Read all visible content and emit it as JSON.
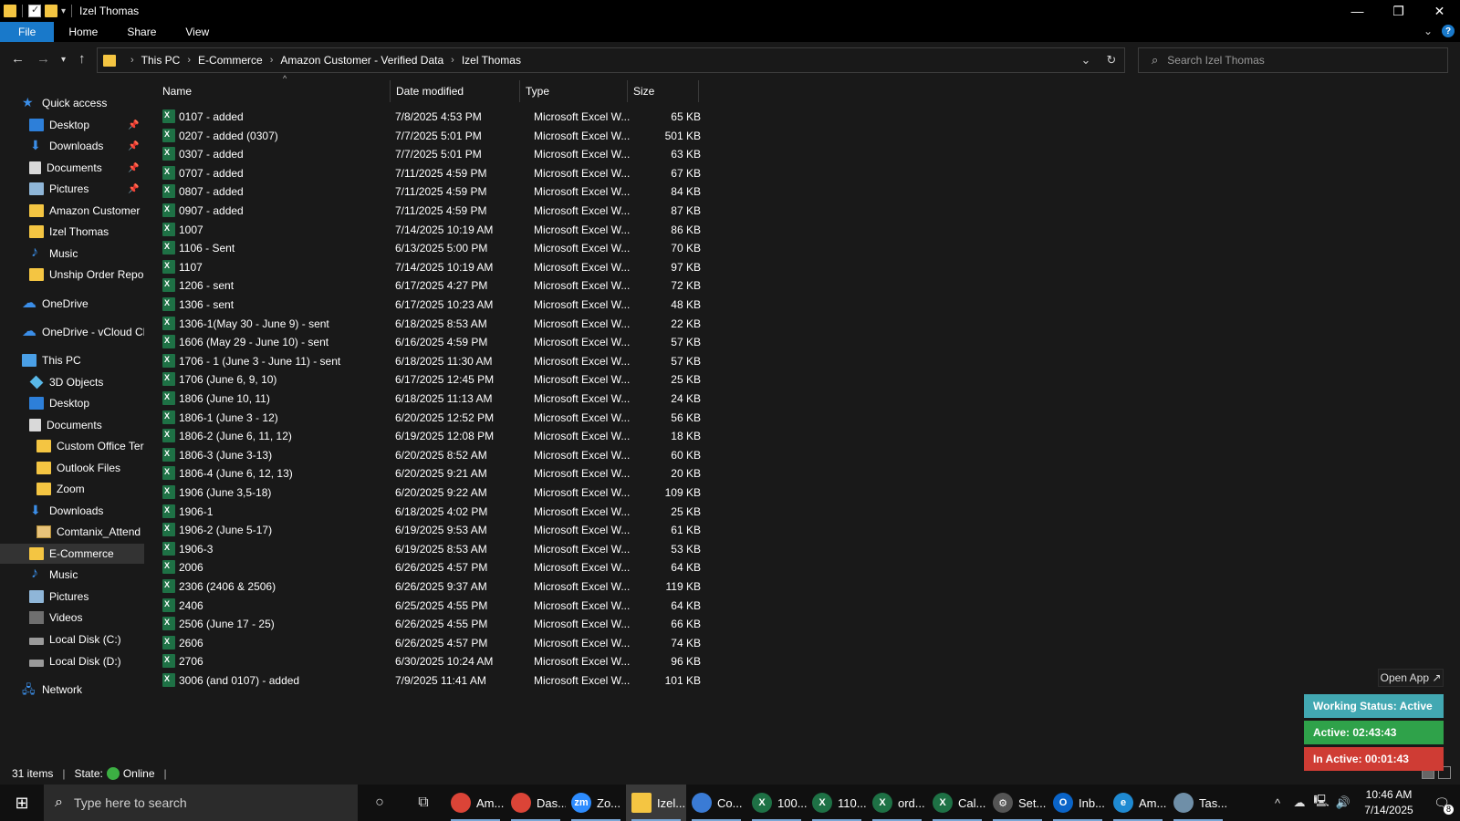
{
  "window": {
    "title": "Izel Thomas",
    "controls": {
      "minimize": "—",
      "maximize": "❐",
      "close": "✕"
    }
  },
  "ribbon": {
    "tabs": [
      "File",
      "Home",
      "Share",
      "View"
    ],
    "help": "?"
  },
  "address": {
    "crumbs": [
      "This PC",
      "E-Commerce",
      "Amazon Customer - Verified Data",
      "Izel Thomas"
    ]
  },
  "search": {
    "placeholder": "Search Izel Thomas"
  },
  "nav": [
    {
      "label": "Quick access",
      "icon": "star-icon",
      "indent": 0
    },
    {
      "label": "Desktop",
      "icon": "desktop-icon",
      "indent": 1,
      "pinned": true
    },
    {
      "label": "Downloads",
      "icon": "download-icon",
      "indent": 1,
      "pinned": true
    },
    {
      "label": "Documents",
      "icon": "documents-icon",
      "indent": 1,
      "pinned": true
    },
    {
      "label": "Pictures",
      "icon": "pictures-icon",
      "indent": 1,
      "pinned": true
    },
    {
      "label": "Amazon Customer",
      "icon": "folder-icon",
      "indent": 1
    },
    {
      "label": "Izel Thomas",
      "icon": "folder-icon",
      "indent": 1
    },
    {
      "label": "Music",
      "icon": "music-icon",
      "indent": 1
    },
    {
      "label": "Unship Order Repor",
      "icon": "folder-icon",
      "indent": 1
    },
    {
      "label": "OneDrive",
      "icon": "cloud-icon",
      "indent": 0
    },
    {
      "label": "OneDrive - vCloud Cl",
      "icon": "cloud-icon",
      "indent": 0
    },
    {
      "label": "This PC",
      "icon": "pc-icon",
      "indent": 0
    },
    {
      "label": "3D Objects",
      "icon": "3d-objects-icon",
      "indent": 1
    },
    {
      "label": "Desktop",
      "icon": "desktop-icon",
      "indent": 1
    },
    {
      "label": "Documents",
      "icon": "documents-icon",
      "indent": 1
    },
    {
      "label": "Custom Office Ter",
      "icon": "folder-icon",
      "indent": 2
    },
    {
      "label": "Outlook Files",
      "icon": "folder-icon",
      "indent": 2
    },
    {
      "label": "Zoom",
      "icon": "folder-icon",
      "indent": 2
    },
    {
      "label": "Downloads",
      "icon": "download-icon",
      "indent": 1
    },
    {
      "label": "Comtanix_Attend",
      "icon": "zip-folder-icon",
      "indent": 2
    },
    {
      "label": "E-Commerce",
      "icon": "folder-icon",
      "indent": 1,
      "selected": true
    },
    {
      "label": "Music",
      "icon": "music-icon",
      "indent": 1
    },
    {
      "label": "Pictures",
      "icon": "pictures-icon",
      "indent": 1
    },
    {
      "label": "Videos",
      "icon": "videos-icon",
      "indent": 1
    },
    {
      "label": "Local Disk (C:)",
      "icon": "disk-icon",
      "indent": 1
    },
    {
      "label": "Local Disk (D:)",
      "icon": "disk-icon",
      "indent": 1
    },
    {
      "label": "Network",
      "icon": "network-icon",
      "indent": 0
    }
  ],
  "columns": {
    "name": "Name",
    "date": "Date modified",
    "type": "Type",
    "size": "Size"
  },
  "files": [
    {
      "name": "0107 - added",
      "date": "7/8/2025 4:53 PM",
      "type": "Microsoft Excel W...",
      "size": "65 KB"
    },
    {
      "name": "0207 - added (0307)",
      "date": "7/7/2025 5:01 PM",
      "type": "Microsoft Excel W...",
      "size": "501 KB"
    },
    {
      "name": "0307 - added",
      "date": "7/7/2025 5:01 PM",
      "type": "Microsoft Excel W...",
      "size": "63 KB"
    },
    {
      "name": "0707 - added",
      "date": "7/11/2025 4:59 PM",
      "type": "Microsoft Excel W...",
      "size": "67 KB"
    },
    {
      "name": "0807 - added",
      "date": "7/11/2025 4:59 PM",
      "type": "Microsoft Excel W...",
      "size": "84 KB"
    },
    {
      "name": "0907 - added",
      "date": "7/11/2025 4:59 PM",
      "type": "Microsoft Excel W...",
      "size": "87 KB"
    },
    {
      "name": "1007",
      "date": "7/14/2025 10:19 AM",
      "type": "Microsoft Excel W...",
      "size": "86 KB"
    },
    {
      "name": "1106 - Sent",
      "date": "6/13/2025 5:00 PM",
      "type": "Microsoft Excel W...",
      "size": "70 KB"
    },
    {
      "name": "1107",
      "date": "7/14/2025 10:19 AM",
      "type": "Microsoft Excel W...",
      "size": "97 KB"
    },
    {
      "name": "1206 - sent",
      "date": "6/17/2025 4:27 PM",
      "type": "Microsoft Excel W...",
      "size": "72 KB"
    },
    {
      "name": "1306 - sent",
      "date": "6/17/2025 10:23 AM",
      "type": "Microsoft Excel W...",
      "size": "48 KB"
    },
    {
      "name": "1306-1(May 30 - June 9) - sent",
      "date": "6/18/2025 8:53 AM",
      "type": "Microsoft Excel W...",
      "size": "22 KB"
    },
    {
      "name": "1606 (May 29 - June 10) - sent",
      "date": "6/16/2025 4:59 PM",
      "type": "Microsoft Excel W...",
      "size": "57 KB"
    },
    {
      "name": "1706 - 1 (June 3 - June 11) - sent",
      "date": "6/18/2025 11:30 AM",
      "type": "Microsoft Excel W...",
      "size": "57 KB"
    },
    {
      "name": "1706 (June 6, 9, 10)",
      "date": "6/17/2025 12:45 PM",
      "type": "Microsoft Excel W...",
      "size": "25 KB"
    },
    {
      "name": "1806 (June 10, 11)",
      "date": "6/18/2025 11:13 AM",
      "type": "Microsoft Excel W...",
      "size": "24 KB"
    },
    {
      "name": "1806-1 (June 3 - 12)",
      "date": "6/20/2025 12:52 PM",
      "type": "Microsoft Excel W...",
      "size": "56 KB"
    },
    {
      "name": "1806-2 (June 6, 11, 12)",
      "date": "6/19/2025 12:08 PM",
      "type": "Microsoft Excel W...",
      "size": "18 KB"
    },
    {
      "name": "1806-3 (June 3-13)",
      "date": "6/20/2025 8:52 AM",
      "type": "Microsoft Excel W...",
      "size": "60 KB"
    },
    {
      "name": "1806-4 (June 6, 12, 13)",
      "date": "6/20/2025 9:21 AM",
      "type": "Microsoft Excel W...",
      "size": "20 KB"
    },
    {
      "name": "1906 (June 3,5-18)",
      "date": "6/20/2025 9:22 AM",
      "type": "Microsoft Excel W...",
      "size": "109 KB"
    },
    {
      "name": "1906-1",
      "date": "6/18/2025 4:02 PM",
      "type": "Microsoft Excel W...",
      "size": "25 KB"
    },
    {
      "name": "1906-2 (June 5-17)",
      "date": "6/19/2025 9:53 AM",
      "type": "Microsoft Excel W...",
      "size": "61 KB"
    },
    {
      "name": "1906-3",
      "date": "6/19/2025 8:53 AM",
      "type": "Microsoft Excel W...",
      "size": "53 KB"
    },
    {
      "name": "2006",
      "date": "6/26/2025 4:57 PM",
      "type": "Microsoft Excel W...",
      "size": "64 KB"
    },
    {
      "name": "2306 (2406 & 2506)",
      "date": "6/26/2025 9:37 AM",
      "type": "Microsoft Excel W...",
      "size": "119 KB"
    },
    {
      "name": "2406",
      "date": "6/25/2025 4:55 PM",
      "type": "Microsoft Excel W...",
      "size": "64 KB"
    },
    {
      "name": "2506 (June 17 - 25)",
      "date": "6/26/2025 4:55 PM",
      "type": "Microsoft Excel W...",
      "size": "66 KB"
    },
    {
      "name": "2606",
      "date": "6/26/2025 4:57 PM",
      "type": "Microsoft Excel W...",
      "size": "74 KB"
    },
    {
      "name": "2706",
      "date": "6/30/2025 10:24 AM",
      "type": "Microsoft Excel W...",
      "size": "96 KB"
    },
    {
      "name": "3006 (and 0107) - added",
      "date": "7/9/2025 11:41 AM",
      "type": "Microsoft Excel W...",
      "size": "101 KB"
    }
  ],
  "status": {
    "items": "31 items",
    "state_label": "State:",
    "state_value": "Online"
  },
  "widget": {
    "open_app": "Open App ↗",
    "working_status": "Working Status: Active",
    "active": "Active: 02:43:43",
    "inactive": "In Active: 00:01:43"
  },
  "taskbar": {
    "search_placeholder": "Type here to search",
    "apps": [
      {
        "label": "Am...",
        "icon": "chrome-icon",
        "color": "#db4437"
      },
      {
        "label": "Das...",
        "icon": "chrome-icon",
        "color": "#db4437"
      },
      {
        "label": "Zo...",
        "icon": "zoom-icon",
        "color": "#2d8cff",
        "glyph": "zm"
      },
      {
        "label": "Izel...",
        "icon": "file-explorer-icon",
        "color": "#f4c542",
        "active": true
      },
      {
        "label": "Co...",
        "icon": "copilot-icon",
        "color": "#3a7bd5"
      },
      {
        "label": "100...",
        "icon": "excel-icon",
        "color": "#1e7145",
        "glyph": "X"
      },
      {
        "label": "110...",
        "icon": "excel-icon",
        "color": "#1e7145",
        "glyph": "X"
      },
      {
        "label": "ord...",
        "icon": "excel-icon",
        "color": "#1e7145",
        "glyph": "X"
      },
      {
        "label": "Cal...",
        "icon": "excel-icon",
        "color": "#1e7145",
        "glyph": "X"
      },
      {
        "label": "Set...",
        "icon": "settings-icon",
        "color": "#555555",
        "glyph": "⚙"
      },
      {
        "label": "Inb...",
        "icon": "outlook-icon",
        "color": "#0a64c8",
        "glyph": "O"
      },
      {
        "label": "Am...",
        "icon": "edge-icon",
        "color": "#1f8ad2",
        "glyph": "e"
      },
      {
        "label": "Tas...",
        "icon": "task-manager-icon",
        "color": "#6f8fa8"
      }
    ],
    "time": "10:46 AM",
    "date": "7/14/2025",
    "notifications": "8"
  }
}
